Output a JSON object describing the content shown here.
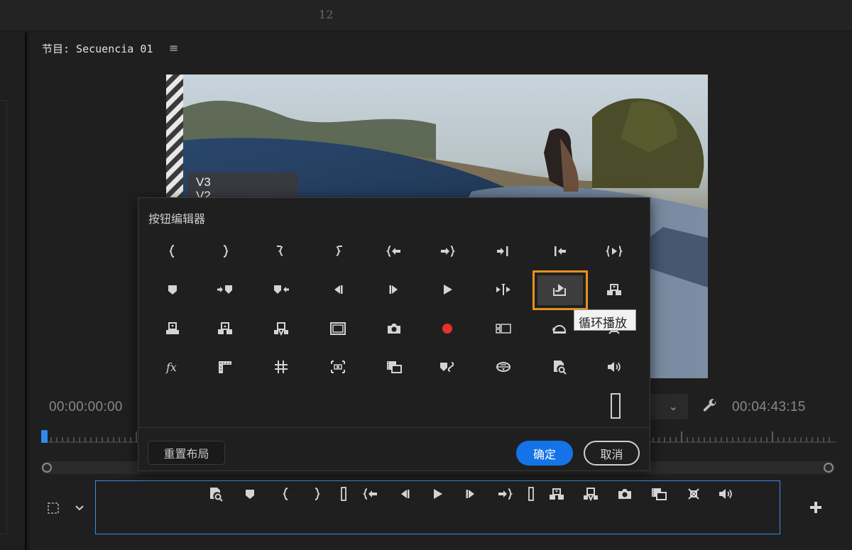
{
  "top_bar": {
    "page_number": "12"
  },
  "program_panel": {
    "title": "节目: Secuencia 01",
    "menu_icon": "hamburger-menu-icon",
    "overlay_track_labels": [
      "V3",
      "V2"
    ],
    "timecode_current": "00:00:00:00",
    "timecode_duration": "00:04:43:15",
    "fit_dropdown_icon": "chevron-down-icon",
    "settings_icon": "wrench-icon"
  },
  "button_editor": {
    "title": "按钮编辑器",
    "rows": [
      [
        "mark-in-icon",
        "mark-out-icon",
        "mark-clip-in-icon",
        "mark-clip-out-icon",
        "go-to-in-icon",
        "go-to-out-icon",
        "go-to-next-edit-icon",
        "go-to-previous-edit-icon",
        "play-in-to-out-icon"
      ],
      [
        "add-marker-icon",
        "go-to-next-marker-icon",
        "go-to-previous-marker-icon",
        "step-back-icon",
        "step-forward-icon",
        "play-icon",
        "play-around-icon",
        "loop-playback-icon",
        "insert-icon"
      ],
      [
        "lift-icon",
        "extract-icon",
        "overwrite-icon",
        "safe-margins-icon",
        "export-frame-icon",
        "record-icon",
        "multi-camera-icon",
        "restore-cropped-icon",
        "toggle-proxies-icon"
      ],
      [
        "fx-bypass-icon",
        "show-rulers-icon",
        "show-guides-icon",
        "snap-in-program-monitor-icon",
        "comparison-view-icon",
        "go-to-marker-link-icon",
        "vr-video-icon",
        "lumetri-scopes-icon",
        "volume-icon"
      ]
    ],
    "highlighted_button": "loop-playback-icon",
    "tooltip": "循环播放",
    "spacer_icon": "spacer-icon",
    "reset_label": "重置布局",
    "ok_label": "确定",
    "cancel_label": "取消"
  },
  "transport_bar": {
    "left_icons": [
      "safe-area-icon",
      "chevron-down-icon"
    ],
    "buttons": [
      "lumetri-scopes-icon",
      "add-marker-icon",
      "mark-in-icon",
      "mark-out-icon",
      "spacer-icon",
      "go-to-in-icon",
      "step-back-icon",
      "play-icon",
      "step-forward-icon",
      "go-to-out-icon",
      "spacer-icon",
      "insert-icon",
      "overwrite-icon",
      "export-frame-icon",
      "comparison-view-icon",
      "toggle-proxies-icon",
      "volume-icon"
    ],
    "add_button_icon": "plus-icon"
  },
  "colors": {
    "accent": "#1473e6",
    "highlight": "#e8901e",
    "record": "#e8302d",
    "selection_border": "#3a8fe0"
  }
}
